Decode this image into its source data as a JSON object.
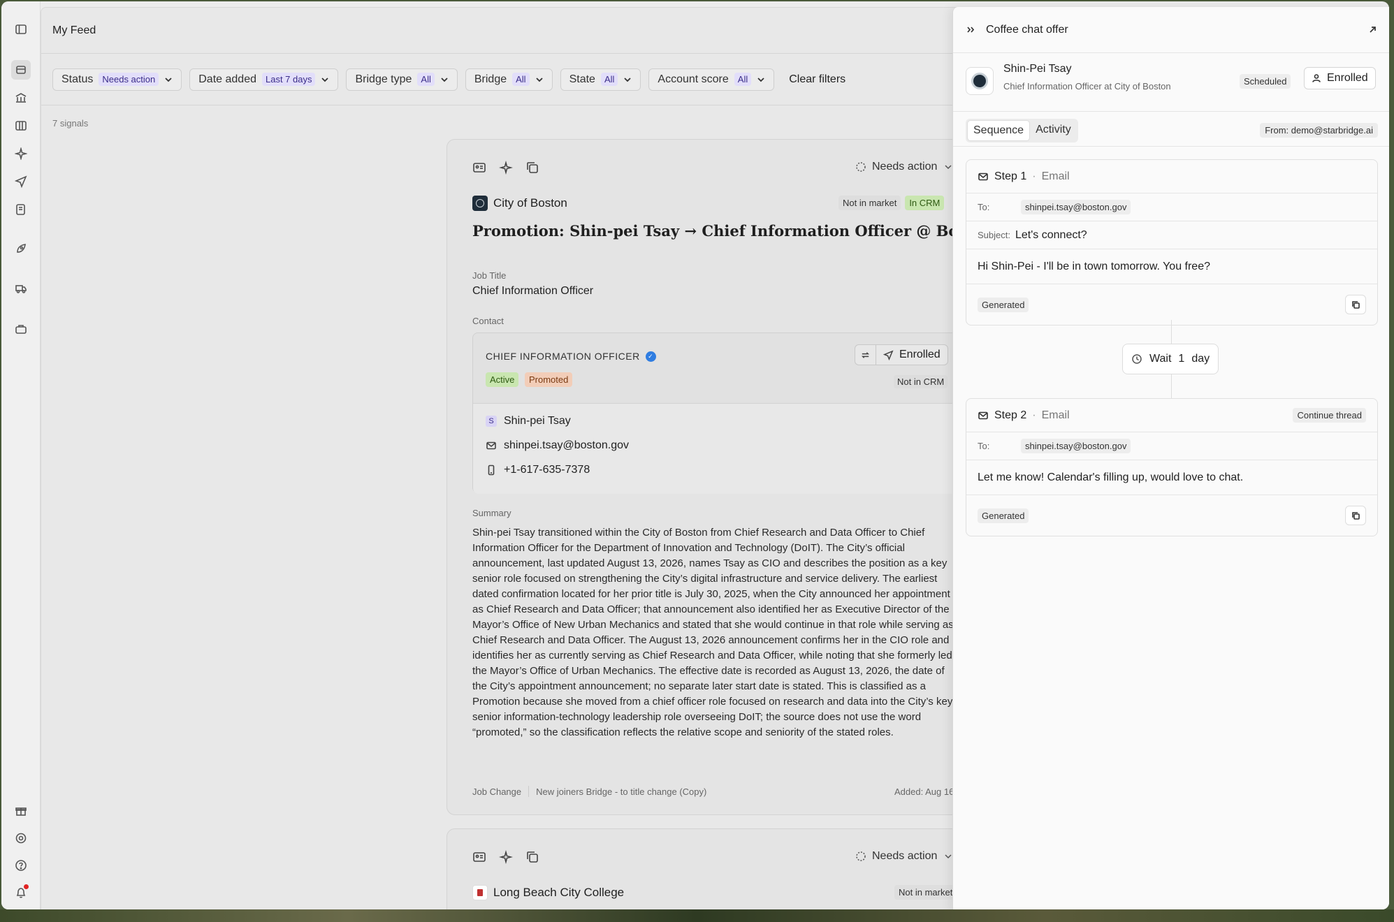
{
  "feed": {
    "title": "My Feed",
    "filters": [
      {
        "label": "Status",
        "value": "Needs action"
      },
      {
        "label": "Date added",
        "value": "Last 7 days"
      },
      {
        "label": "Bridge type",
        "value": "All"
      },
      {
        "label": "Bridge",
        "value": "All"
      },
      {
        "label": "State",
        "value": "All"
      },
      {
        "label": "Account score",
        "value": "All"
      }
    ],
    "clear_filters": "Clear filters",
    "signals_count": "7 signals"
  },
  "card1": {
    "status": "Needs action",
    "org": "City of Boston",
    "badge_market": "Not in market",
    "badge_crm": "In CRM",
    "headline": "Promotion: Shin-pei Tsay → Chief Information Officer @ Boston",
    "job_title_label": "Job Title",
    "job_title": "Chief Information Officer",
    "contact_label": "Contact",
    "contact": {
      "title": "CHIEF INFORMATION OFFICER",
      "pill_active": "Active",
      "pill_promoted": "Promoted",
      "enrolled": "Enrolled",
      "crm": "Not in CRM",
      "initial": "S",
      "name": "Shin-pei Tsay",
      "email": "shinpei.tsay@boston.gov",
      "phone": "+1-617-635-7378"
    },
    "summary_label": "Summary",
    "summary": "Shin-pei Tsay transitioned within the City of Boston from Chief Research and Data Officer to Chief Information Officer for the Department of Innovation and Technology (DoIT). The City’s official announcement, last updated August 13, 2026, names Tsay as CIO and describes the position as a key senior role focused on strengthening the City’s digital infrastructure and service delivery. The earliest dated confirmation located for her prior title is July 30, 2025, when the City announced her appointment as Chief Research and Data Officer; that announcement also identified her as Executive Director of the Mayor’s Office of New Urban Mechanics and stated that she would continue in that role while serving as Chief Research and Data Officer. The August 13, 2026 announcement confirms her in the CIO role and identifies her as currently serving as Chief Research and Data Officer, while noting that she formerly led the Mayor’s Office of Urban Mechanics. The effective date is recorded as August 13, 2026, the date of the City’s appointment announcement; no separate later start date is stated. This is classified as a Promotion because she moved from a chief officer role focused on research and data into the City’s key senior information-technology leadership role overseeing DoIT; the source does not use the word “promoted,” so the classification reflects the relative scope and seniority of the stated roles.",
    "footer_type": "Job Change",
    "footer_bridge": "New joiners Bridge - to title change (Copy)",
    "added": "Added: Aug 16"
  },
  "card2": {
    "status": "Needs action",
    "org": "Long Beach City College",
    "badge_market": "Not in market"
  },
  "panel": {
    "title": "Coffee chat offer",
    "person_name": "Shin-Pei Tsay",
    "person_sub": "Chief Information Officer at City of Boston",
    "scheduled": "Scheduled",
    "enrolled": "Enrolled",
    "tab_sequence": "Sequence",
    "tab_activity": "Activity",
    "from": "From: demo@starbridge.ai",
    "step1": {
      "title": "Step 1",
      "type": "Email",
      "to_label": "To:",
      "to": "shinpei.tsay@boston.gov",
      "subject_label": "Subject:",
      "subject": "Let's connect?",
      "body": "Hi Shin-Pei - I'll be in town tomorrow. You free?",
      "generated": "Generated"
    },
    "wait": {
      "label": "Wait",
      "count": "1",
      "unit": "day"
    },
    "step2": {
      "title": "Step 2",
      "type": "Email",
      "continue": "Continue thread",
      "to_label": "To:",
      "to": "shinpei.tsay@boston.gov",
      "body": "Let me know! Calendar's filling up, would love to chat.",
      "generated": "Generated"
    }
  },
  "colors": {
    "accent_purple": "#3b2d8a",
    "green_badge": "#c9e6b0",
    "promoted_badge": "#f2cdb8",
    "notification": "#e02424"
  },
  "icons": {
    "rail": [
      "sidebar-toggle-icon",
      "feed-icon",
      "bank-icon",
      "columns-icon",
      "sparkle-icon",
      "send-icon",
      "document-icon",
      "rocket-icon",
      "truck-icon",
      "briefcase-icon",
      "gift-icon",
      "settings-icon",
      "help-icon",
      "bell-icon"
    ]
  }
}
